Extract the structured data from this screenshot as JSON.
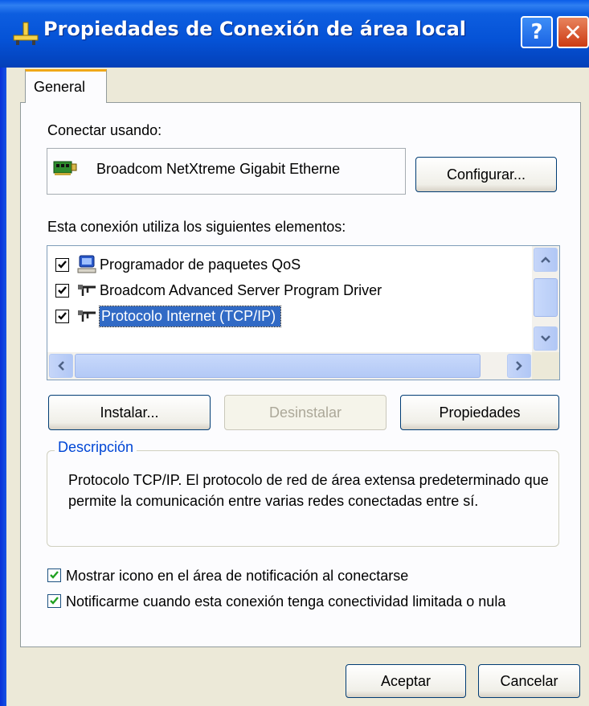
{
  "window": {
    "title": "Propiedades de Conexión de área local",
    "help_button": "?",
    "close_button": "✕"
  },
  "tabs": [
    {
      "label": "General",
      "active": true
    }
  ],
  "general": {
    "connect_using_label": "Conectar usando:",
    "adapter_name": "Broadcom NetXtreme Gigabit Etherne",
    "configure_button": "Configurar...",
    "components_label": "Esta conexión utiliza los siguientes elementos:",
    "components": [
      {
        "label": "Programador de paquetes QoS",
        "checked": true,
        "icon": "qos-scheduler-icon"
      },
      {
        "label": "Broadcom Advanced Server Program Driver",
        "checked": true,
        "icon": "network-protocol-icon"
      },
      {
        "label": "Protocolo Internet (TCP/IP)",
        "checked": true,
        "icon": "network-protocol-icon",
        "selected": true
      }
    ],
    "install_button": "Instalar...",
    "uninstall_button": "Desinstalar",
    "properties_button": "Propiedades",
    "description_title": "Descripción",
    "description_text": "Protocolo TCP/IP. El protocolo de red de área extensa predeterminado que permite la comunicación entre varias redes conectadas entre sí.",
    "show_icon_option": {
      "label": "Mostrar icono en el área de notificación al conectarse",
      "checked": true
    },
    "notify_option": {
      "label": "Notificarme cuando esta conexión tenga conectividad limitada o nula",
      "checked": true
    }
  },
  "footer": {
    "ok_button": "Aceptar",
    "cancel_button": "Cancelar"
  },
  "colors": {
    "titlebar": "#0552d6",
    "selection": "#316ac5",
    "group_title": "#0046d5"
  }
}
